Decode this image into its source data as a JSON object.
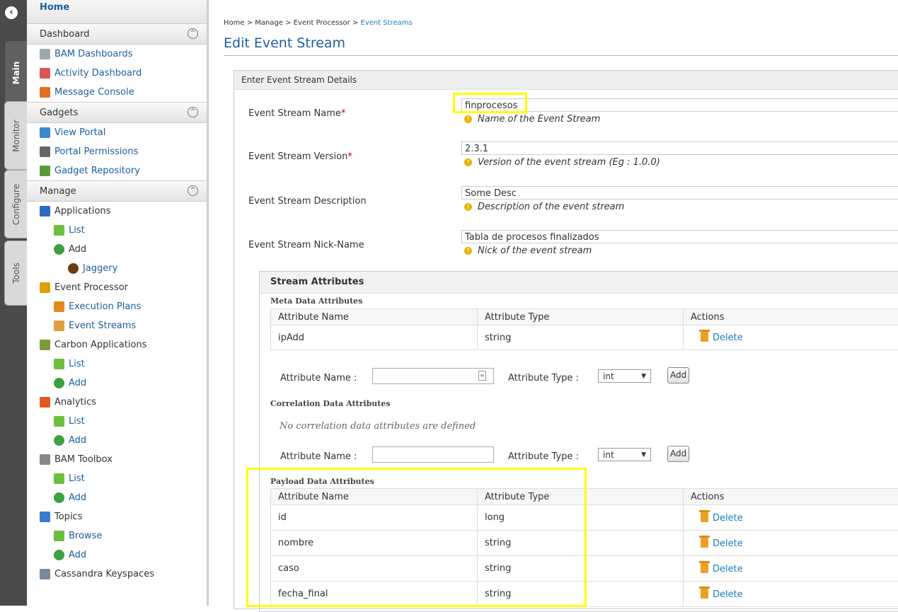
{
  "vertical_tabs": [
    "Main",
    "Monitor",
    "Configure",
    "Tools"
  ],
  "sidebar": {
    "home": "Home",
    "sections": [
      {
        "title": "Dashboard",
        "items": [
          {
            "label": "BAM Dashboards",
            "icon": "dashboard-icon",
            "level": 0
          },
          {
            "label": "Activity Dashboard",
            "icon": "activity-chart-icon",
            "level": 0
          },
          {
            "label": "Message Console",
            "icon": "console-icon",
            "level": 0
          }
        ]
      },
      {
        "title": "Gadgets",
        "items": [
          {
            "label": "View Portal",
            "icon": "portal-icon",
            "level": 0
          },
          {
            "label": "Portal Permissions",
            "icon": "permissions-icon",
            "level": 0
          },
          {
            "label": "Gadget Repository",
            "icon": "gadget-repository-icon",
            "level": 0
          }
        ]
      },
      {
        "title": "Manage",
        "items": [
          {
            "label": "Applications",
            "icon": "applications-icon",
            "level": 0,
            "dark": true
          },
          {
            "label": "List",
            "icon": "list-icon",
            "level": 1
          },
          {
            "label": "Add",
            "icon": "add-icon",
            "level": 1,
            "dark": true
          },
          {
            "label": "Jaggery",
            "icon": "jaggery-icon",
            "level": 2
          },
          {
            "label": "Event Processor",
            "icon": "event-processor-icon",
            "level": 0,
            "dark": true
          },
          {
            "label": "Execution Plans",
            "icon": "execution-plans-icon",
            "level": 1
          },
          {
            "label": "Event Streams",
            "icon": "event-streams-icon",
            "level": 1
          },
          {
            "label": "Carbon Applications",
            "icon": "carbon-apps-icon",
            "level": 0,
            "dark": true
          },
          {
            "label": "List",
            "icon": "list-icon",
            "level": 1
          },
          {
            "label": "Add",
            "icon": "add-icon",
            "level": 1
          },
          {
            "label": "Analytics",
            "icon": "analytics-icon",
            "level": 0,
            "dark": true
          },
          {
            "label": "List",
            "icon": "list-icon",
            "level": 1
          },
          {
            "label": "Add",
            "icon": "add-icon",
            "level": 1
          },
          {
            "label": "BAM Toolbox",
            "icon": "toolbox-icon",
            "level": 0,
            "dark": true
          },
          {
            "label": "List",
            "icon": "list-icon",
            "level": 1
          },
          {
            "label": "Add",
            "icon": "add-icon",
            "level": 1
          },
          {
            "label": "Topics",
            "icon": "topics-icon",
            "level": 0,
            "dark": true
          },
          {
            "label": "Browse",
            "icon": "list-icon",
            "level": 1
          },
          {
            "label": "Add",
            "icon": "add-icon",
            "level": 1
          },
          {
            "label": "Cassandra Keyspaces",
            "icon": "keyspaces-icon",
            "level": 0,
            "dark": true
          }
        ]
      }
    ]
  },
  "breadcrumb": {
    "path": "Home > Manage > Event Processor > ",
    "current": "Event Streams"
  },
  "page_title": "Edit Event Stream",
  "panel_title": "Enter Event Stream Details",
  "fields": [
    {
      "label": "Event Stream Name",
      "required": true,
      "value": "finprocesos",
      "help": "Name of the Event Stream"
    },
    {
      "label": "Event Stream Version",
      "required": true,
      "value": "2.3.1",
      "help": "Version of the event stream (Eg : 1.0.0)"
    },
    {
      "label": "Event Stream Description",
      "required": false,
      "value": "Some Desc",
      "help": "Description of the event stream"
    },
    {
      "label": "Event Stream Nick-Name",
      "required": false,
      "value": "Tabla de procesos finalizados",
      "help": "Nick of the event stream"
    }
  ],
  "stream_attributes": {
    "title": "Stream Attributes",
    "columns": [
      "Attribute Name",
      "Attribute Type",
      "Actions"
    ],
    "delete_label": "Delete",
    "add_name_label": "Attribute Name :",
    "add_type_label": "Attribute Type :",
    "add_type_value": "int",
    "add_button": "Add",
    "meta": {
      "title": "Meta Data Attributes",
      "rows": [
        {
          "name": "ipAdd",
          "type": "string"
        }
      ]
    },
    "correlation": {
      "title": "Correlation Data Attributes",
      "empty": "No correlation data attributes are defined"
    },
    "payload": {
      "title": "Payload Data Attributes",
      "rows": [
        {
          "name": "id",
          "type": "long"
        },
        {
          "name": "nombre",
          "type": "string"
        },
        {
          "name": "caso",
          "type": "string"
        },
        {
          "name": "fecha_final",
          "type": "string"
        }
      ]
    }
  },
  "colors": {
    "link": "#1a5f9e",
    "highlight": "#ffff00",
    "required": "#cc0000",
    "sidebar_strip": "#4a4a4a"
  }
}
